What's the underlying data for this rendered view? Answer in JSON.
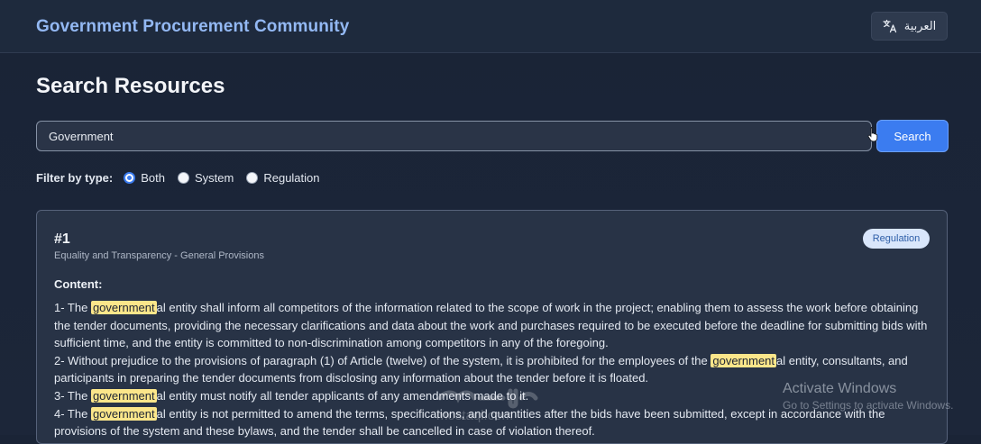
{
  "header": {
    "title": "Government Procurement Community",
    "language_button": "العربية",
    "language_icon": "translate-icon"
  },
  "search": {
    "page_title": "Search Resources",
    "query": "Government",
    "button_label": "Search"
  },
  "filter": {
    "label": "Filter by type:",
    "options": [
      {
        "label": "Both",
        "checked": true
      },
      {
        "label": "System",
        "checked": false
      },
      {
        "label": "Regulation",
        "checked": false
      }
    ]
  },
  "results": [
    {
      "number": "#1",
      "subtitle": "Equality and Transparency - General Provisions",
      "badge": "Regulation",
      "content_label": "Content:",
      "content": {
        "l1_a": "1- The ",
        "l1_hl": "government",
        "l1_b": "al entity shall inform all competitors of the information related to the scope of work in the project; enabling them to assess the work before obtaining the tender documents, providing the necessary clarifications and data about the work and purchases required to be executed before the deadline for submitting bids with sufficient time, and the entity is committed to non-discrimination among competitors in any of the foregoing.",
        "l2_a": "2- Without prejudice to the provisions of paragraph (1) of Article (twelve) of the system, it is prohibited for the employees of the ",
        "l2_hl": "government",
        "l2_b": "al entity, consultants, and participants in preparing the tender documents from disclosing any information about the tender before it is floated.",
        "l3_a": "3- The ",
        "l3_hl": "government",
        "l3_b": "al entity must notify all tender applicants of any amendments made to it.",
        "l4_a": "4- The ",
        "l4_hl": "government",
        "l4_b": "al entity is not permitted to amend the terms, specifications, and quantities after the bids have been submitted, except in accordance with the provisions of the system and these bylaws, and the tender shall be cancelled in case of violation thereof."
      }
    }
  ],
  "overlay": {
    "activate_title": "Activate Windows",
    "activate_sub": "Go to Settings to activate Windows.",
    "logo_text": "mostaql.com"
  },
  "colors": {
    "accent": "#3b7cf0",
    "title": "#93b8f3",
    "highlight": "#fbe68a"
  }
}
